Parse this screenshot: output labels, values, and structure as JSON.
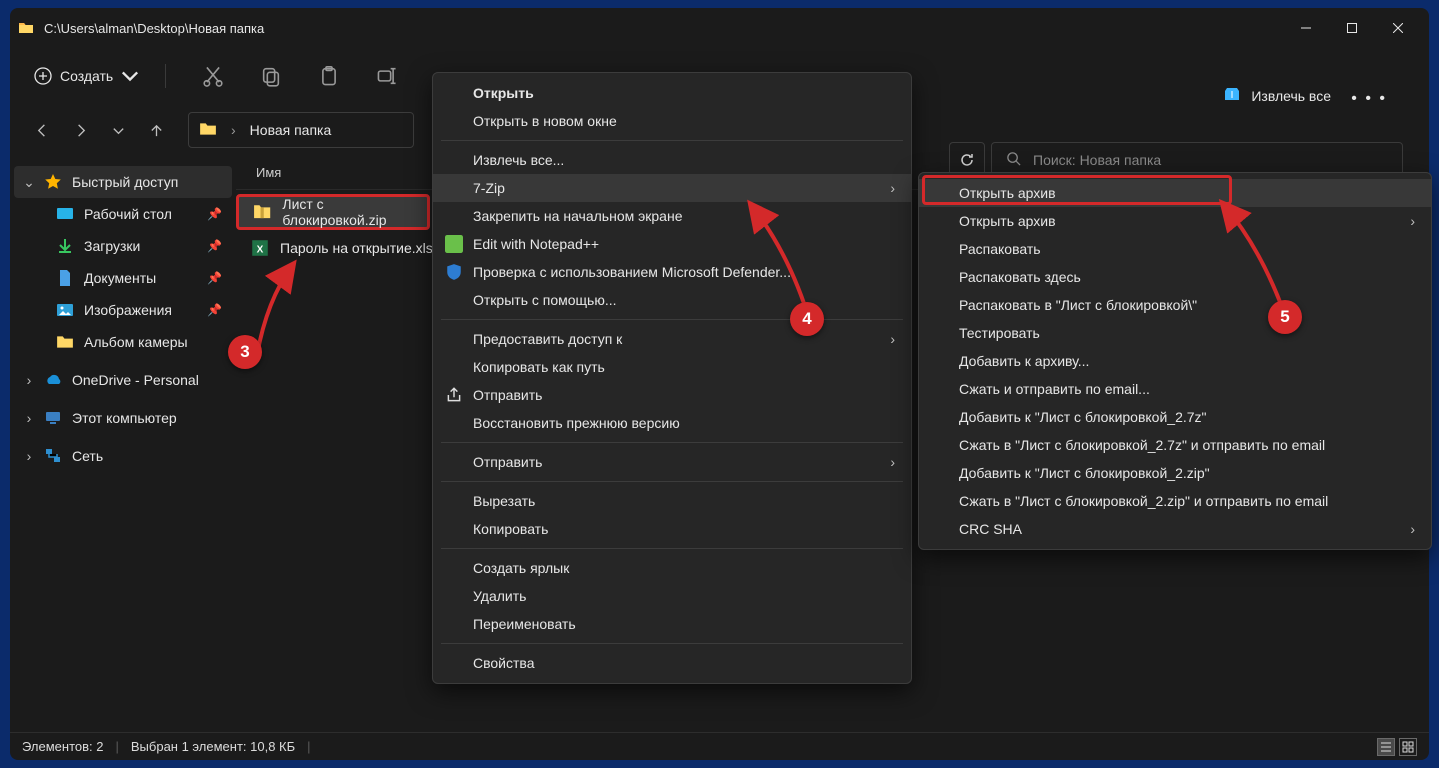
{
  "title_path": "C:\\Users\\alman\\Desktop\\Новая папка",
  "toolbar": {
    "create_label": "Создать",
    "extract_label": "Извлечь все"
  },
  "breadcrumb": {
    "segment": "Новая папка"
  },
  "search": {
    "placeholder": "Поиск: Новая папка"
  },
  "sidebar": {
    "quick": "Быстрый доступ",
    "desktop": "Рабочий стол",
    "downloads": "Загрузки",
    "documents": "Документы",
    "pictures": "Изображения",
    "camera": "Альбом камеры",
    "onedrive": "OneDrive - Personal",
    "thispc": "Этот компьютер",
    "network": "Сеть"
  },
  "columns": {
    "name": "Имя"
  },
  "files": {
    "f1": "Лист с блокировкой.zip",
    "f2": "Пароль на открытие.xlsx"
  },
  "menu1": {
    "open": "Открыть",
    "open_new": "Открыть в новом окне",
    "extract_all": "Извлечь все...",
    "sevenzip": "7-Zip",
    "pin_start": "Закрепить на начальном экране",
    "edit_npp": "Edit with Notepad++",
    "defender": "Проверка с использованием Microsoft Defender...",
    "open_with": "Открыть с помощью...",
    "grant_access": "Предоставить доступ к",
    "copy_path": "Копировать как путь",
    "share": "Отправить",
    "restore_ver": "Восстановить прежнюю версию",
    "send_to": "Отправить",
    "cut": "Вырезать",
    "copy": "Копировать",
    "shortcut": "Создать ярлык",
    "delete": "Удалить",
    "rename": "Переименовать",
    "properties": "Свойства"
  },
  "menu2": {
    "open_archive1": "Открыть архив",
    "open_archive2": "Открыть архив",
    "extract": "Распаковать",
    "extract_here": "Распаковать здесь",
    "extract_to": "Распаковать в \"Лист с блокировкой\\\"",
    "test": "Тестировать",
    "add_to": "Добавить к архиву...",
    "compress_email": "Сжать и отправить по email...",
    "add_7z": "Добавить к \"Лист с блокировкой_2.7z\"",
    "compress_7z_email": "Сжать в \"Лист с блокировкой_2.7z\" и отправить по email",
    "add_zip": "Добавить к \"Лист с блокировкой_2.zip\"",
    "compress_zip_email": "Сжать в \"Лист с блокировкой_2.zip\" и отправить по email",
    "crc": "CRC SHA"
  },
  "status": {
    "elements": "Элементов: 2",
    "selected": "Выбран 1 элемент: 10,8 КБ"
  },
  "callouts": {
    "c3": "3",
    "c4": "4",
    "c5": "5"
  }
}
